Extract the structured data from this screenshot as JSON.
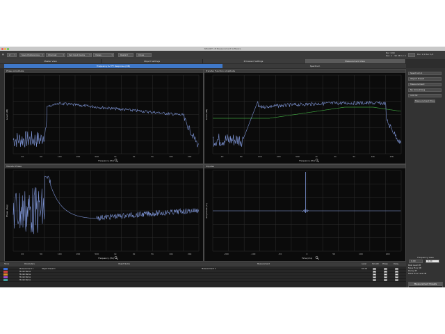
{
  "window": {
    "title": "SMAART v8 Measurement Software"
  },
  "toolbar": {
    "config_value": "2",
    "buttons": [
      "Save Preferences",
      "Channel",
      "Set Input Gains",
      "Views",
      "Restart",
      "Close"
    ],
    "right_text_1": "Bar 1/90",
    "right_text_2": "Rec. 1 - 90 dB 1 / 4",
    "right_text_3": "Dur 1/1  Rec 1/2"
  },
  "tabs": [
    "Master View",
    "Object Settings",
    "Processor Settings",
    "Measurement View"
  ],
  "active_tab": 3,
  "subtabs": [
    "Frequency & FFT Response (DB)",
    "Spectrum"
  ],
  "active_subtab": 0,
  "panels": {
    "p1": {
      "title": "Phase Amplitude",
      "xlabel": "Frequency (Hz)",
      "ylabel": "Level (dB)",
      "ticks": [
        "20",
        "50",
        "100",
        "200",
        "500",
        "1k",
        "2k",
        "5k",
        "10k",
        "20k"
      ]
    },
    "p2": {
      "title": "Transfer Function Amplitude",
      "xlabel": "Frequency (Hz)",
      "ylabel": "Level (dB)",
      "ticks": [
        "20",
        "50",
        "100",
        "200",
        "500",
        "1k",
        "2k",
        "5k",
        "10k",
        "20k"
      ]
    },
    "p3": {
      "title": "Transfer Phase",
      "xlabel": "Frequency (Hz)",
      "ylabel": "Phase (deg)",
      "ticks": [
        "20",
        "50",
        "100",
        "200",
        "500",
        "1k",
        "2k",
        "5k",
        "10k",
        "20k"
      ]
    },
    "p4": {
      "title": "Impulse",
      "xlabel": "Time (ms)",
      "ylabel": "Amplitude (%)",
      "ticks": [
        "-200",
        "-100",
        "-50",
        "0",
        "50",
        "100",
        "200"
      ]
    }
  },
  "sidebar": {
    "buttons": [
      "Spectrum 1",
      "Object Preset",
      "Measurement",
      "No Smoothing",
      "100 Hz",
      "Measurement Presets"
    ],
    "freq_label": "Frequency View",
    "freq_value_1": "0.00",
    "freq_value_2": "0.00",
    "stats": [
      "Peak Level dB",
      "Noise Floor dB",
      "Decay dB",
      "Noise Floor Level dB"
    ],
    "panel_title": "Measurement Presets",
    "radios": [
      "Live",
      "Fast",
      "Slow"
    ]
  },
  "table": {
    "headers": [
      "Show",
      "Parameters",
      "Object Name",
      "Measurement",
      "Level",
      "Smooth",
      "Phase",
      "Delay",
      "Gain"
    ],
    "rows": [
      {
        "name": "Measurement 1",
        "color": "#3a6fd8",
        "object": "Object Preset 1",
        "measurement": "Measurement 1",
        "level": "62 dB"
      },
      {
        "name": "Model Name",
        "color": "#d04040",
        "object": "",
        "measurement": "",
        "level": ""
      },
      {
        "name": "Model Name",
        "color": "#e08a2a",
        "object": "",
        "measurement": "",
        "level": ""
      },
      {
        "name": "Model Name",
        "color": "#9a4ad0",
        "object": "",
        "measurement": "",
        "level": ""
      },
      {
        "name": "Model Name",
        "color": "#40a0a0",
        "object": "",
        "measurement": "",
        "level": ""
      }
    ]
  },
  "colors": {
    "trace_blue": "#7f96d8",
    "trace_green": "#3c9c3c",
    "accent": "#3f78c8"
  }
}
